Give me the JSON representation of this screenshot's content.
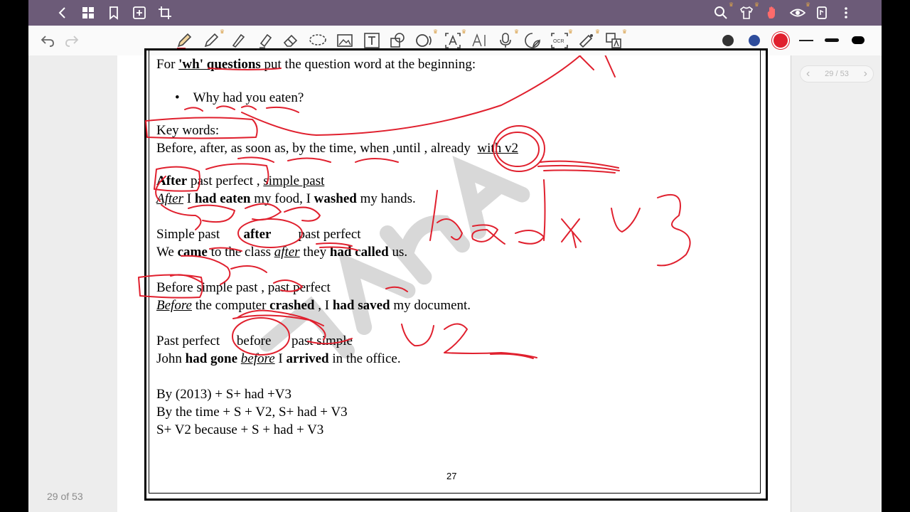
{
  "toolbar_icons": [
    "back-icon",
    "grid-icon",
    "bookmark-icon",
    "add-page-icon",
    "crop-icon",
    "search-icon",
    "shirt-icon",
    "hand-icon",
    "eye-icon",
    "doc-icon",
    "more-icon"
  ],
  "tools": [
    "undo",
    "redo",
    "pen",
    "pencil",
    "brush",
    "highlighter",
    "eraser",
    "lasso",
    "image",
    "text",
    "shape",
    "read",
    "text-select",
    "ai",
    "mic",
    "sticker",
    "ocr",
    "laser",
    "translate"
  ],
  "colors": {
    "black": "#333333",
    "blue": "#2f4d9c",
    "red": "#e0202e",
    "accent": "#6c5b78",
    "ink": "#e0202e"
  },
  "pager": {
    "label": "29 / 53",
    "prev": "‹",
    "next": "›"
  },
  "footer": {
    "page_of": "29 of 53"
  },
  "document": {
    "wh_prefix": "For ",
    "wh_bold": "'wh' questions",
    "wh_suffix": " put the question word at the beginning:",
    "bullet_mark": "•",
    "bullet": "Why had you eaten?",
    "key_words": "Key words:",
    "kw_line": "Before, after, as soon as, by the time, when ,until , already",
    "kw_with": "with v2",
    "after_head": "After",
    "after_rule": " past perfect , ",
    "after_rule2": "simple past",
    "after_ex_1": "After",
    "after_ex_2": " I ",
    "after_ex_3": "had eaten",
    "after_ex_4": " my food, I ",
    "after_ex_5": "washed",
    "after_ex_6": " my hands.",
    "sp_head": "Simple past",
    "sp_after": "after",
    "sp_pp": "past perfect",
    "we_1": "We ",
    "we_2": "came",
    "we_3": " to the class ",
    "we_4": "after",
    "we_5": " they ",
    "we_6": "had called",
    "we_7": " us.",
    "before_head": "Before",
    "before_rule": " simple past  , past perfect",
    "before_ex_1": "Before",
    "before_ex_2": " the computer ",
    "before_ex_3": "crashed",
    "before_ex_4": " , I ",
    "before_ex_5": "had saved",
    "before_ex_6": " my document.",
    "pp_head": "Past perfect",
    "pp_before": "before",
    "pp_ps": "past simple",
    "john_1": "John ",
    "john_2": "had gone",
    "john_3": " ",
    "john_4": "before",
    "john_5": " I ",
    "john_6": "arrived",
    "john_7": " in the office.",
    "f1": "By (2013) + S+ had +V3",
    "f2": "By the time + S + V2, S+ had + V3",
    "f3": "S+ V2  because + S + had + V3",
    "page_number": "27"
  }
}
